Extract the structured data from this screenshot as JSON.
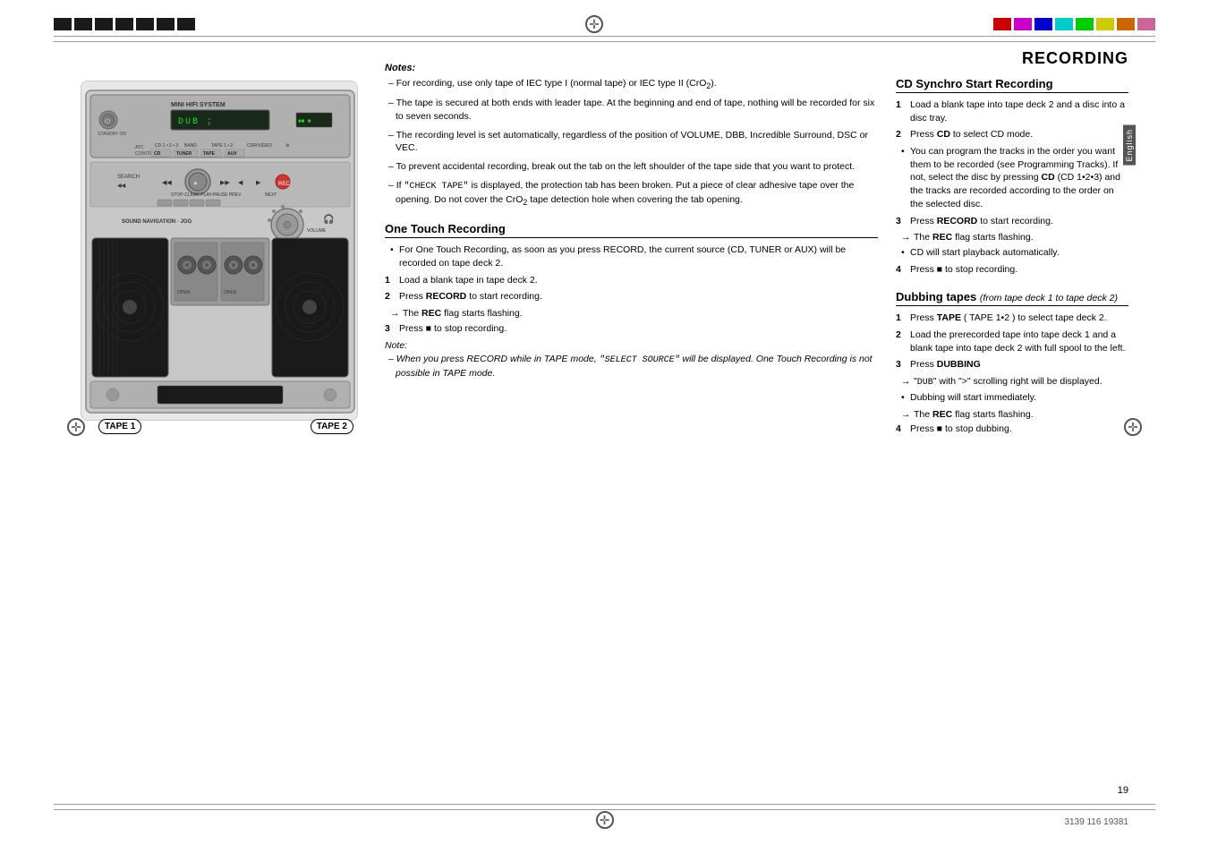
{
  "page": {
    "title": "RECORDING",
    "number": "19",
    "product_code": "3139 116 19381"
  },
  "top_bar": {
    "left_blocks": [
      "black",
      "black",
      "black",
      "black",
      "black",
      "black",
      "black"
    ],
    "right_blocks": [
      "red",
      "magenta",
      "blue",
      "cyan",
      "green",
      "yellow",
      "orange",
      "pink"
    ]
  },
  "notes_section": {
    "header": "Notes:",
    "items": [
      "For recording, use only tape of IEC type I (normal tape) or IEC type II (CrO₂).",
      "The tape is secured at both ends with leader tape.  At the beginning and end of tape, nothing will be recorded for six to seven seconds.",
      "The recording level is set automatically, regardless of the position of VOLUME, DBB, Incredible Surround, DSC or VEC.",
      "To prevent accidental recording, break out the tab on the left shoulder of the tape side that you want to protect.",
      "If \"CHECK TAPE\" is displayed, the protection tab has been broken. Put a piece of clear adhesive tape over the opening.  Do not cover the CrO₂ tape detection hole when covering the tab opening."
    ]
  },
  "one_touch_recording": {
    "title": "One Touch Recording",
    "intro": "For One Touch Recording, as soon as you press RECORD, the current source (CD, TUNER or AUX) will be recorded on tape deck 2.",
    "steps": [
      {
        "num": "1",
        "text": "Load a blank tape in tape deck 2."
      },
      {
        "num": "2",
        "text": "Press RECORD to start recording."
      },
      {
        "arrow": "The REC flag starts flashing."
      },
      {
        "num": "3",
        "text": "Press ■ to stop recording."
      }
    ],
    "note_header": "Note:",
    "note_items": [
      "When you press RECORD while in TAPE mode, \"SELECT SOURCE\" will be displayed.  One Touch Recording is not possible in TAPE mode."
    ]
  },
  "cd_synchro": {
    "title": "CD Synchro Start Recording",
    "steps": [
      {
        "num": "1",
        "text": "Load a blank tape into tape deck 2 and a disc into a disc tray."
      },
      {
        "num": "2",
        "text": "Press CD to select CD mode."
      }
    ],
    "bullet": "You can program the tracks in the order you want them to be recorded (see Programming Tracks). If not,  select the disc by pressing CD (CD 1•2•3) and the tracks are recorded according to the order on the selected disc.",
    "steps2": [
      {
        "num": "3",
        "text": "Press RECORD to start recording."
      },
      {
        "arrow": "The REC flag starts flashing."
      }
    ],
    "bullet2": "CD will start playback automatically.",
    "steps3": [
      {
        "num": "4",
        "text": "Press ■ to stop recording."
      }
    ]
  },
  "dubbing_tapes": {
    "title": "Dubbing tapes",
    "subtitle": "(from tape deck 1 to tape deck 2)",
    "steps": [
      {
        "num": "1",
        "text": "Press TAPE ( TAPE 1•2 ) to select tape deck 2."
      },
      {
        "num": "2",
        "text": "Load the prerecorded tape into tape deck 1 and a blank tape into tape deck 2 with full spool to the left."
      },
      {
        "num": "3",
        "text": "Press DUBBING"
      },
      {
        "arrow": "\"DUB\" with \">\" scrolling right will be displayed."
      }
    ],
    "bullet": "Dubbing will start immediately.",
    "arrow": "The REC flag starts flashing.",
    "steps2": [
      {
        "num": "4",
        "text": "Press ■ to stop dubbing."
      }
    ]
  },
  "english_label": "English",
  "tape1_label": "TAPE 1",
  "tape2_label": "TAPE 2"
}
